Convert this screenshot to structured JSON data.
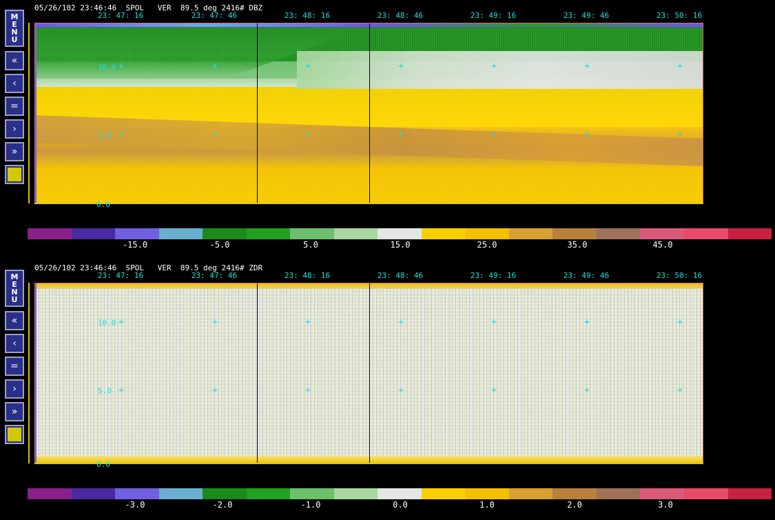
{
  "panels": [
    {
      "header": "05/26/102 23:46:46  SPOL   VER  89.5 deg 2416# DBZ",
      "field": "DBZ",
      "time_labels": [
        "23: 47: 16",
        "23: 47: 46",
        "23: 48: 16",
        "23: 48: 46",
        "23: 49: 16",
        "23: 49: 46",
        "23: 50: 16"
      ],
      "y_labels": [
        "10.0",
        "5.0",
        "0.0"
      ],
      "colorbar": {
        "colors": [
          "#8a1f8a",
          "#4a2aa0",
          "#7060e0",
          "#6aaed0",
          "#1a8a1a",
          "#22a022",
          "#6cc06c",
          "#a8d7a0",
          "#e6e6e6",
          "#f8d000",
          "#f2c000",
          "#d8a030",
          "#b8803a",
          "#a07058",
          "#d85a78",
          "#e84a6a",
          "#c82040"
        ],
        "labels": [
          "-15.0",
          "-5.0",
          "5.0",
          "15.0",
          "25.0",
          "35.0",
          "45.0"
        ]
      }
    },
    {
      "header": "05/26/102 23:46:46  SPOL   VER  89.5 deg 2416# ZDR",
      "field": "ZDR",
      "time_labels": [
        "23: 47: 16",
        "23: 47: 46",
        "23: 48: 16",
        "23: 48: 46",
        "23: 49: 16",
        "23: 49: 46",
        "23: 50: 16"
      ],
      "y_labels": [
        "10.0",
        "5.0",
        "0.0"
      ],
      "colorbar": {
        "colors": [
          "#8a1f8a",
          "#4a2aa0",
          "#7060e0",
          "#6aaed0",
          "#1a8a1a",
          "#22a022",
          "#6cc06c",
          "#a8d7a0",
          "#e6e6e6",
          "#f8d000",
          "#f2c000",
          "#d8a030",
          "#b8803a",
          "#a07058",
          "#d85a78",
          "#e84a6a",
          "#c82040"
        ],
        "labels": [
          "-3.0",
          "-2.0",
          "-1.0",
          "0.0",
          "1.0",
          "2.0",
          "3.0"
        ]
      }
    }
  ],
  "side_buttons": {
    "menu_label": "MENU",
    "icons": [
      "fast-rewind-icon",
      "rewind-icon",
      "equals-icon",
      "forward-icon",
      "fast-forward-icon",
      "color-swatch-icon"
    ],
    "glyphs": [
      "«",
      "‹",
      "=",
      "›",
      "»"
    ]
  }
}
